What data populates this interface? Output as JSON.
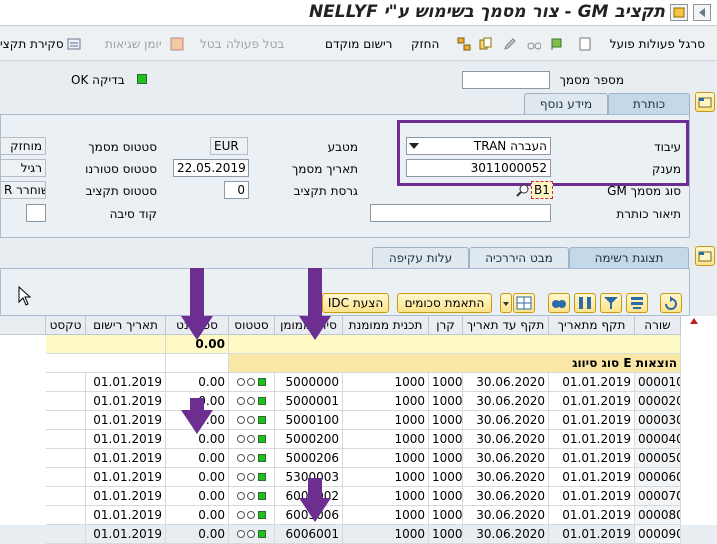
{
  "window": {
    "title": "תקציב GM - צור מסמך בשימוש ע\"י NELLYF"
  },
  "toolbar": {
    "items": [
      {
        "label": "סרגל פעולות פועל",
        "enabled": true
      },
      {
        "label": "החזק",
        "enabled": true
      },
      {
        "label": "רישום מוקדם",
        "enabled": true
      },
      {
        "label": "בטל פעולה",
        "enabled": false
      },
      {
        "label": "בטל",
        "enabled": false
      },
      {
        "label": "יומן שגיאות",
        "enabled": false
      },
      {
        "label": "סקירת תקצי",
        "enabled": true
      }
    ]
  },
  "header": {
    "doc_number_label": "מספר מסמך",
    "doc_number_value": "",
    "check_ok_label": "בדיקה OK"
  },
  "header_tabs": [
    "כותרת",
    "מידע נוסף"
  ],
  "form": {
    "process_label": "עיבוד",
    "process_value": "TRAN העברה",
    "grantor_label": "מענק",
    "grantor_value": "3011000052",
    "gm_doc_type_label": "סוג מסמך GM",
    "gm_doc_type_value": "B1",
    "header_desc_label": "תיאור כותרת",
    "header_desc_value": "",
    "currency_label": "מטבע",
    "currency_value": "EUR",
    "doc_date_label": "תאריך מסמך",
    "doc_date_value": "22.05.2019",
    "budget_version_label": "גרסת תקציב",
    "budget_version_value": "0",
    "doc_status_label": "סטטוס מסמך",
    "doc_status_value": "מוחזק",
    "reversal_status_label": "סטטוס סטורנו",
    "reversal_status_value": "רגיל",
    "budget_status_label": "סטטוס תקציב",
    "budget_status_value": "R שוחרר",
    "reason_code_label": "קוד סיבה",
    "reason_code_value": ""
  },
  "list_tabs": [
    "תצוגת רשימה",
    "מבט היררכיה",
    "עלות עקיפה"
  ],
  "list_toolbar": {
    "match_amounts": "התאמת סכומים",
    "idc_proposal": "הצעת IDC"
  },
  "table": {
    "columns": [
      "שורה",
      "תקף מתאריך",
      "תקף עד תאריך",
      "קרן",
      "תכנית ממומנת",
      "סיווג ממומן",
      "סטטוס",
      "סכום נט",
      "תאריך רישום",
      "טקסט"
    ],
    "total_amount": "0.00",
    "group_label": "סוג סיווג E הוצאות",
    "rows": [
      {
        "line": "000010",
        "from": "01.01.2019",
        "to": "30.06.2020",
        "fund": "1000",
        "program": "1000",
        "class": "5000000",
        "amount": "0.00",
        "posting_date": "01.01.2019"
      },
      {
        "line": "000020",
        "from": "01.01.2019",
        "to": "30.06.2020",
        "fund": "1000",
        "program": "1000",
        "class": "5000001",
        "amount": "0.00",
        "posting_date": "01.01.2019"
      },
      {
        "line": "000030",
        "from": "01.01.2019",
        "to": "30.06.2020",
        "fund": "1000",
        "program": "1000",
        "class": "5000100",
        "amount": "0.00",
        "posting_date": "01.01.2019"
      },
      {
        "line": "000040",
        "from": "01.01.2019",
        "to": "30.06.2020",
        "fund": "1000",
        "program": "1000",
        "class": "5000200",
        "amount": "0.00",
        "posting_date": "01.01.2019"
      },
      {
        "line": "000050",
        "from": "01.01.2019",
        "to": "30.06.2020",
        "fund": "1000",
        "program": "1000",
        "class": "5000206",
        "amount": "0.00",
        "posting_date": "01.01.2019"
      },
      {
        "line": "000060",
        "from": "01.01.2019",
        "to": "30.06.2020",
        "fund": "1000",
        "program": "1000",
        "class": "5300003",
        "amount": "0.00",
        "posting_date": "01.01.2019"
      },
      {
        "line": "000070",
        "from": "01.01.2019",
        "to": "30.06.2020",
        "fund": "1000",
        "program": "1000",
        "class": "6001002",
        "amount": "0.00",
        "posting_date": "01.01.2019"
      },
      {
        "line": "000080",
        "from": "01.01.2019",
        "to": "30.06.2020",
        "fund": "1000",
        "program": "1000",
        "class": "6005006",
        "amount": "0.00",
        "posting_date": "01.01.2019"
      },
      {
        "line": "000090",
        "from": "01.01.2019",
        "to": "30.06.2020",
        "fund": "1000",
        "program": "1000",
        "class": "6006001",
        "amount": "0.00",
        "posting_date": "01.01.2019"
      }
    ]
  },
  "colors": {
    "accent_purple": "#6c2e90",
    "status_green": "#1fbf1f",
    "group_row": "#f9e7a6"
  }
}
